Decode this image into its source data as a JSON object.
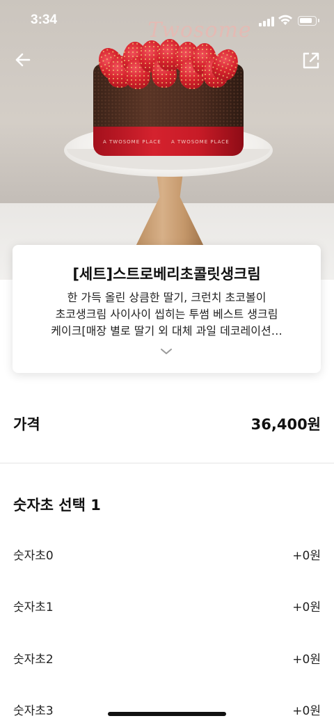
{
  "status_bar": {
    "time": "3:34"
  },
  "hero": {
    "brand_logo": "Twosome",
    "ribbon_text": "A TWOSOME PLACE"
  },
  "nav": {
    "back_icon": "arrow-left-icon",
    "share_icon": "share-external-icon"
  },
  "product": {
    "title": "[세트]스트로베리초콜릿생크림",
    "description_lines": [
      "한 가득 올린 상큼한 딸기, 크런치 초코볼이",
      "초코생크림 사이사이 씹히는 투썸 베스트 생크림",
      "케이크[매장 별로 딸기 외 대체 과일 데코레이션…"
    ],
    "expand_icon": "chevron-down-icon"
  },
  "price": {
    "label": "가격",
    "value": "36,400원"
  },
  "options": {
    "section_title": "숫자초 선택 1",
    "items": [
      {
        "name": "숫자초0",
        "extra": "+0원"
      },
      {
        "name": "숫자초1",
        "extra": "+0원"
      },
      {
        "name": "숫자초2",
        "extra": "+0원"
      },
      {
        "name": "숫자초3",
        "extra": "+0원"
      }
    ]
  },
  "colors": {
    "ribbon": "#c81b27",
    "divider": "#e4e4e4"
  }
}
